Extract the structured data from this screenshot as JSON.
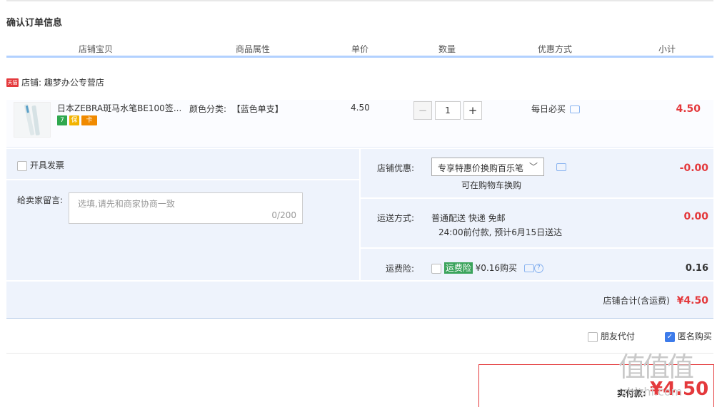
{
  "page": {
    "title": "确认订单信息"
  },
  "columns": [
    "店铺宝贝",
    "商品属性",
    "单价",
    "数量",
    "优惠方式",
    "小计"
  ],
  "shop": {
    "tag": "天猫",
    "label": "店铺: 趣梦办公专营店"
  },
  "item": {
    "name": "日本ZEBRA斑马水笔BE100签...",
    "attr_label": "颜色分类:",
    "attr_value": "【蓝色单支】",
    "price": "4.50",
    "quantity": "1",
    "promo": "每日必买",
    "subtotal": "4.50",
    "badges": [
      "7",
      "保",
      "卡"
    ]
  },
  "invoice": {
    "label": "开具发票"
  },
  "memo": {
    "label": "给卖家留言:",
    "placeholder": "选填,请先和商家协商一致",
    "count": "0/200"
  },
  "shop_discount": {
    "label": "店铺优惠:",
    "selected": "专享特惠价换购百乐笔",
    "note": "可在购物车换购",
    "amount": "-0.00"
  },
  "shipping": {
    "label": "运送方式:",
    "line1": "普通配送 快递 免邮",
    "line2": "24:00前付款, 预计6月15日送达",
    "amount": "0.00"
  },
  "insurance": {
    "label": "运费险:",
    "badge": "运费险",
    "text": "¥0.16购买",
    "amount": "0.16"
  },
  "total": {
    "label": "店铺合计(含运费)",
    "amount": "¥4.50"
  },
  "options": {
    "friend_pay": "朋友代付",
    "anonymous": "匿名购买"
  },
  "pay": {
    "label": "实付款:",
    "amount": "¥4.50"
  },
  "watermark": {
    "logo": "值值值",
    "url": "zhizhi.com"
  }
}
